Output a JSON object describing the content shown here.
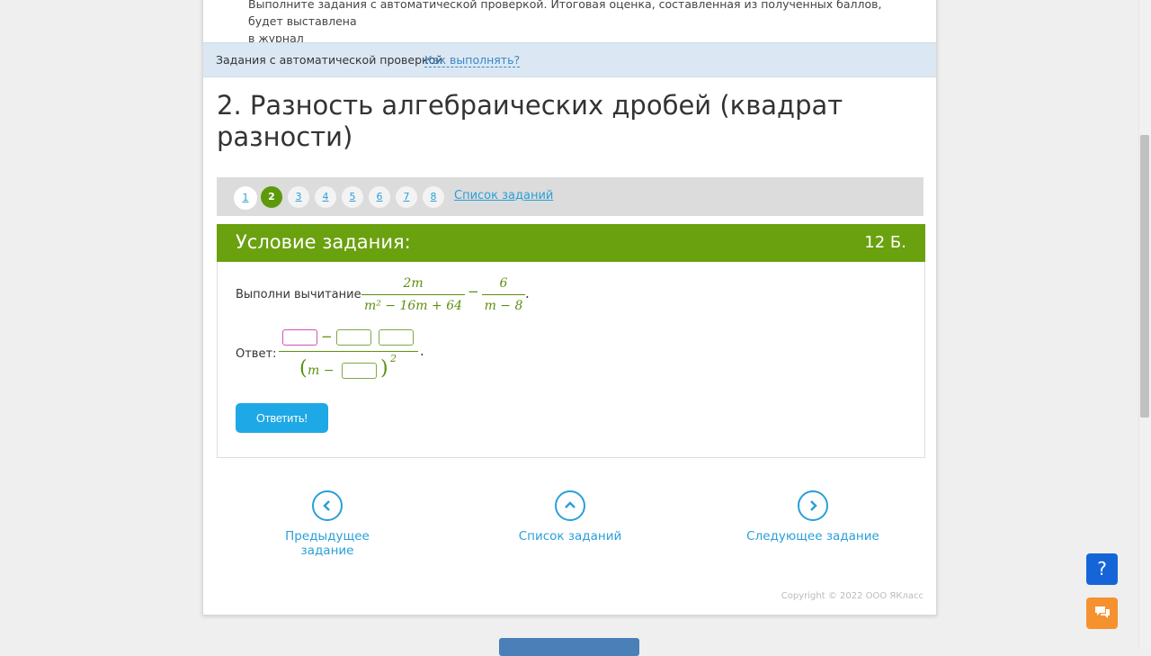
{
  "intro": {
    "line1": "Выполните задания с автоматической проверкой. Итоговая оценка, составленная из полученных баллов, будет выставлена",
    "line2": "в журнал"
  },
  "infobar": {
    "label": "Задания с автоматической проверкой",
    "how_link": "Как выполнять?"
  },
  "title": "2. Разность алгебраических дробей (квадрат разности)",
  "pager": {
    "pages": [
      "1",
      "2",
      "3",
      "4",
      "5",
      "6",
      "7",
      "8"
    ],
    "active": "2",
    "list_link": "Список заданий"
  },
  "task": {
    "header": "Условие задания:",
    "points": "12 Б.",
    "question_text": "Выполни вычитание",
    "frac1_num": "2m",
    "frac1_den": "m² − 16m + 64",
    "minus": "−",
    "frac2_num": "6",
    "frac2_den": "m − 8",
    "dot": ".",
    "answer_label": "Ответ:",
    "answer_den_m": "(m −",
    "answer_den_close": ")",
    "answer_exp": "2",
    "submit": "Ответить!"
  },
  "nav": {
    "prev": "Предыдущее задание",
    "list": "Список заданий",
    "next": "Следующее задание"
  },
  "copyright": "Copyright © 2022 ООО ЯКласс",
  "help_button": "?",
  "colors": {
    "green": "#6aa10f",
    "blue": "#2a9fd8",
    "button": "#1ea8e6",
    "help": "#1565d8",
    "chat": "#f5922f"
  }
}
